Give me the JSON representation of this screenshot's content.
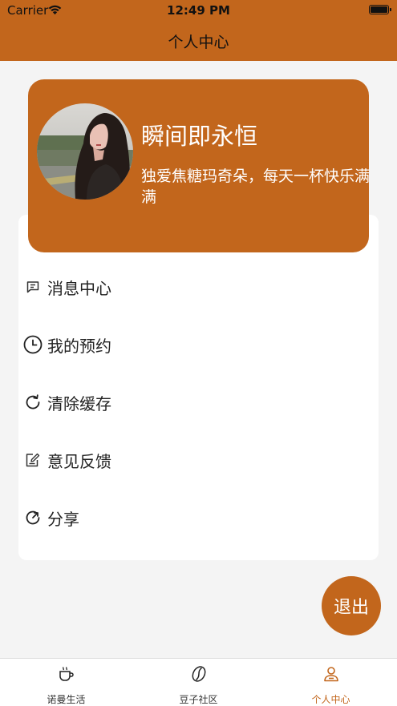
{
  "status_bar": {
    "carrier": "Carrier",
    "time": "12:49 PM"
  },
  "nav": {
    "title": "个人中心"
  },
  "profile": {
    "username": "瞬间即永恒",
    "bio": "独爱焦糖玛奇朵，每天一杯快乐满满"
  },
  "menu": {
    "items": [
      {
        "label": "消息中心",
        "icon": "message-icon"
      },
      {
        "label": "我的预约",
        "icon": "clock-icon"
      },
      {
        "label": "清除缓存",
        "icon": "refresh-icon"
      },
      {
        "label": "意见反馈",
        "icon": "feedback-icon"
      },
      {
        "label": "分享",
        "icon": "share-icon"
      }
    ]
  },
  "logout": {
    "label": "退出"
  },
  "tabbar": {
    "tabs": [
      {
        "label": "诺曼生活",
        "icon": "coffee-cup-icon",
        "active": false
      },
      {
        "label": "豆子社区",
        "icon": "coffee-bean-icon",
        "active": false
      },
      {
        "label": "个人中心",
        "icon": "person-icon",
        "active": true
      }
    ]
  },
  "colors": {
    "accent": "#c2661c",
    "background": "#f4f4f4",
    "card": "#ffffff"
  }
}
